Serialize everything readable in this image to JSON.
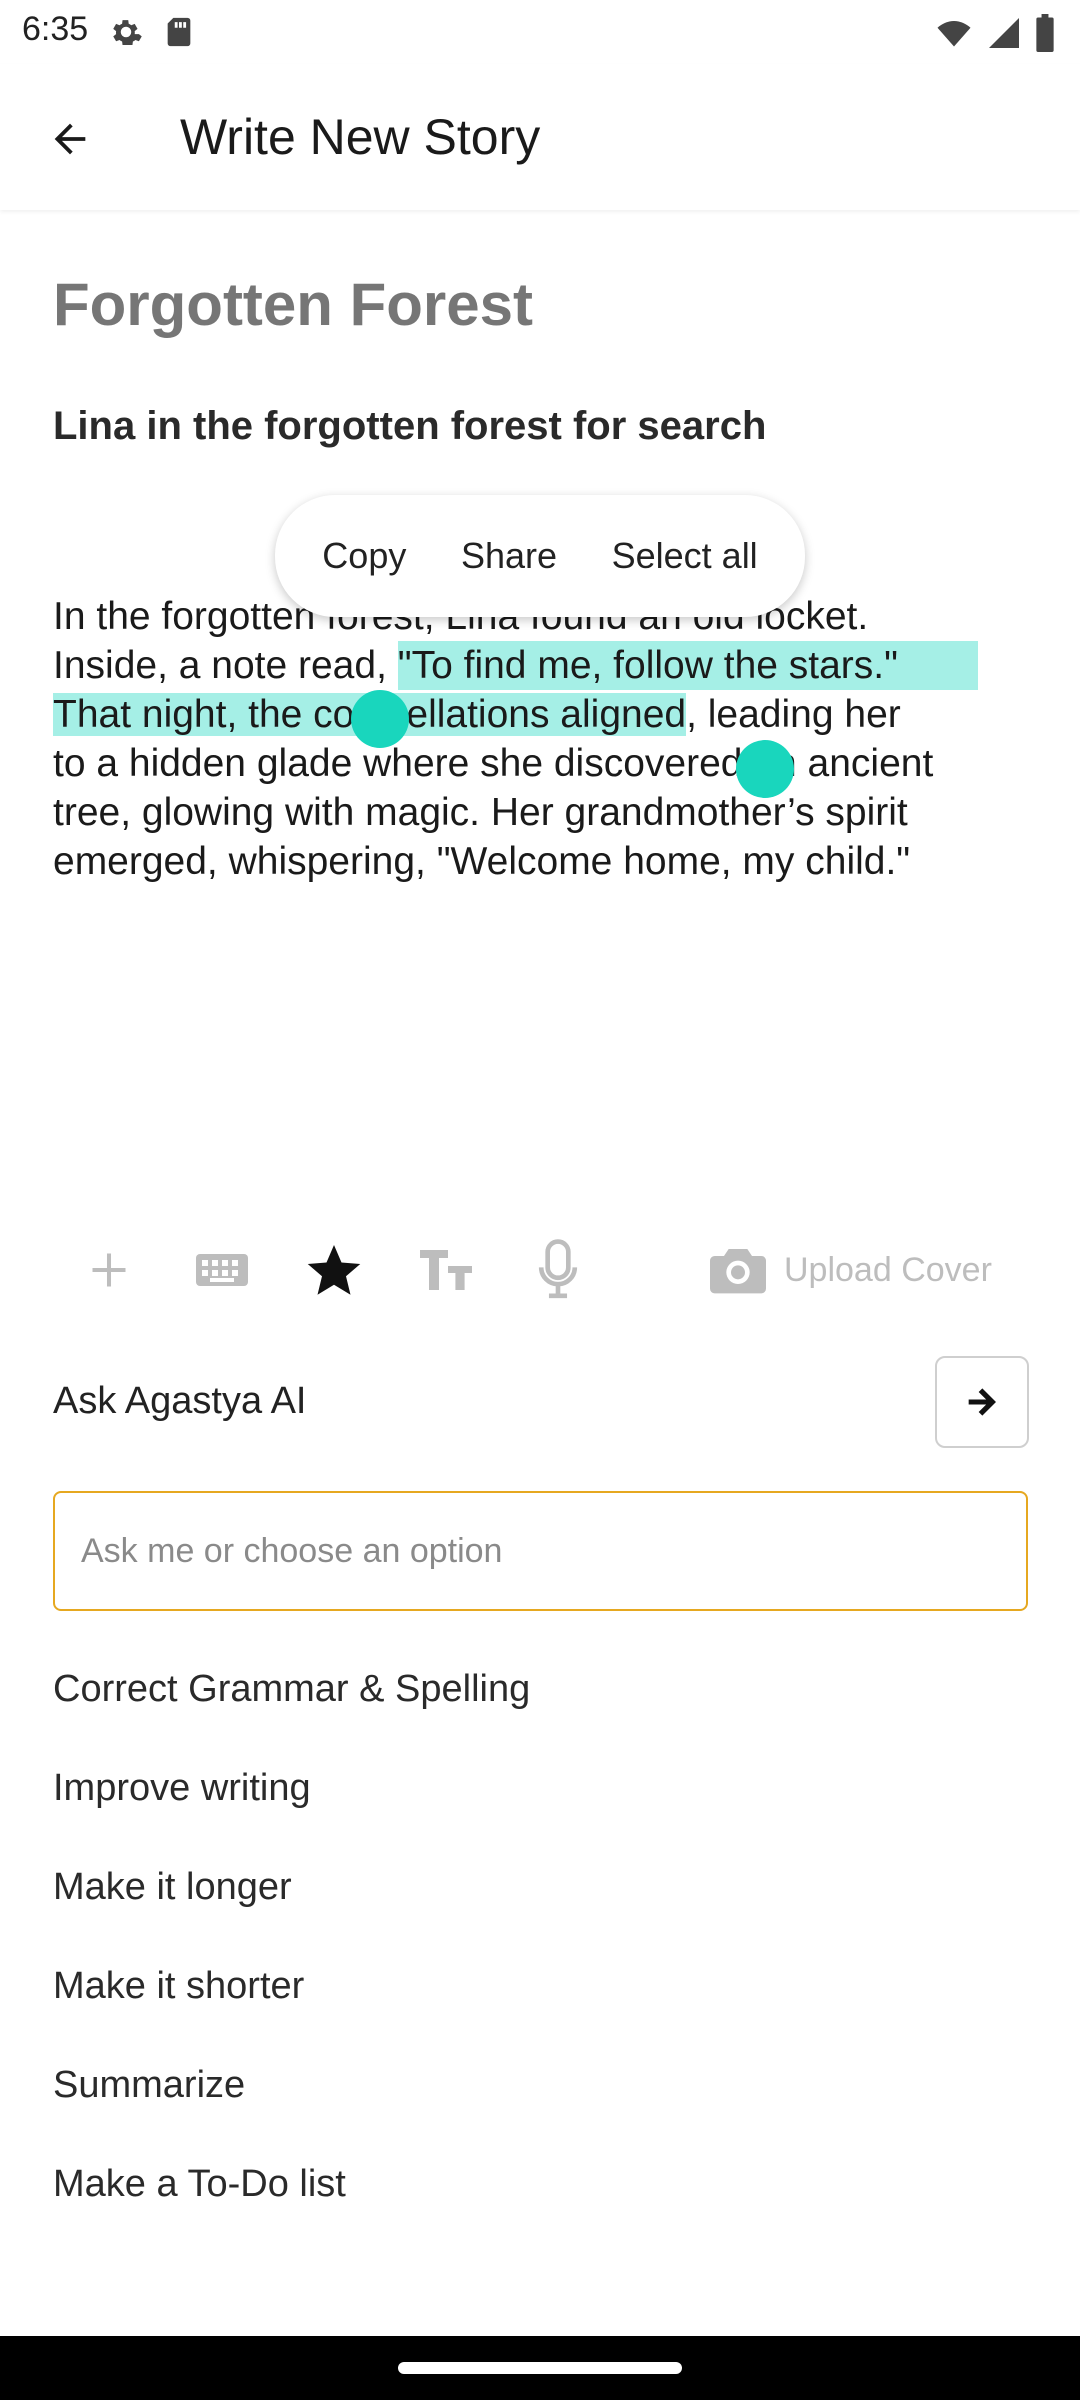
{
  "status_bar": {
    "time": "6:35",
    "left_icons": [
      "gear-icon",
      "sd-card-icon"
    ],
    "right_icons": [
      "wifi-icon",
      "signal-icon",
      "battery-icon"
    ]
  },
  "app_bar": {
    "title": "Write New Story",
    "back_icon": "arrow-left-icon"
  },
  "story": {
    "title": "Forgotten Forest",
    "subtitle": "Lina in the forgotten forest for search",
    "lines": [
      {
        "before": "In the forgotten forest, Lina found an old locket.",
        "selected": "",
        "after": ""
      },
      {
        "before": "Inside, a note read, ",
        "selected": "\"To find me, follow the stars.\"",
        "after": ""
      },
      {
        "before": "",
        "selected": "That night, the constellations aligned",
        "after": ", leading her"
      },
      {
        "before": "to a hidden glade where she discovered an ancient",
        "selected": "",
        "after": ""
      },
      {
        "before": "tree, glowing with magic. Her grandmother’s spirit",
        "selected": "",
        "after": ""
      },
      {
        "before": "emerged, whispering, \"Welcome home, my child.\"",
        "selected": "",
        "after": ""
      }
    ],
    "selection_color": "#a5efe6",
    "handle_color": "#19d6bd"
  },
  "context_menu": {
    "items": [
      "Copy",
      "Share",
      "Select all"
    ]
  },
  "toolbar": {
    "tools": [
      "plus-icon",
      "keyboard-icon",
      "star-icon",
      "text-size-icon",
      "microphone-icon"
    ],
    "upload_cover_label": "Upload Cover"
  },
  "ai": {
    "label": "Ask Agastya AI",
    "input_placeholder": "Ask me or choose an option",
    "accent_color": "#e6a820",
    "options": [
      "Correct Grammar & Spelling",
      "Improve writing",
      "Make it longer",
      "Make it shorter",
      "Summarize",
      "Make a To-Do list"
    ]
  }
}
